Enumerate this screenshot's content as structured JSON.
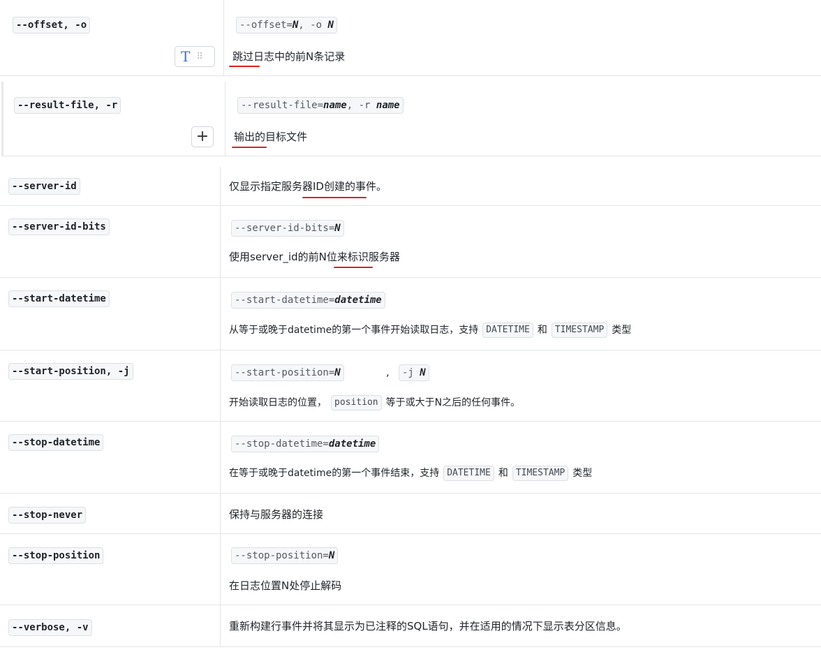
{
  "rows": [
    {
      "option": "--offset, -o",
      "format_pre": "--offset=",
      "format_b1": "N",
      "format_mid": ", -o ",
      "format_b2": "N",
      "description": "跳过日志中的前N条记录"
    },
    {
      "option": "--result-file, -r",
      "format_pre": "--result-file=",
      "format_b1": "name",
      "format_mid": ", -r ",
      "format_b2": "name",
      "description": "输出的目标文件"
    },
    {
      "option": "--server-id",
      "description": "仅显示指定服务器ID创建的事件。"
    },
    {
      "option": "--server-id-bits",
      "format_pre": "--server-id-bits=",
      "format_b1": "N",
      "description": "使用server_id的前N位来标识服务器"
    },
    {
      "option": "--start-datetime",
      "format_pre": "--start-datetime=",
      "format_b1": "datetime",
      "desc_a": "从等于或晚于datetime的第一个事件开始读取日志，支持",
      "code_a": "DATETIME",
      "desc_b": "和",
      "code_b": "TIMESTAMP",
      "desc_c": "类型"
    },
    {
      "option": "--start-position, -j",
      "format_pre": "--start-position=",
      "format_b1": "N",
      "format_sep": ",",
      "format2_pre": "-j ",
      "format2_b": "N",
      "desc_a": "开始读取日志的位置，",
      "code_a": "position",
      "desc_b": "等于或大于N之后的任何事件。"
    },
    {
      "option": "--stop-datetime",
      "format_pre": "--stop-datetime=",
      "format_b1": "datetime",
      "desc_a": "在等于或晚于datetime的第一个事件结束，支持",
      "code_a": "DATETIME",
      "desc_b": "和",
      "code_b": "TIMESTAMP",
      "desc_c": "类型"
    },
    {
      "option": "--stop-never",
      "description": "保持与服务器的连接"
    },
    {
      "option": "--stop-position",
      "format_pre": "--stop-position=",
      "format_b1": "N",
      "description": "在日志位置N处停止解码"
    },
    {
      "option": "--verbose, -v",
      "description": "重新构建行事件并将其显示为已注释的SQL语句，并在适用的情况下显示表分区信息。"
    }
  ],
  "toolbar": {
    "text_button": "T",
    "drag_handle": "⠿",
    "add_button": "+"
  },
  "icons": {
    "text_button": "text-format-icon",
    "drag_handle": "drag-handle-icon",
    "add_button": "plus-icon"
  },
  "colors": {
    "annotation_underline": "#e02020",
    "text_button": "#3b6fe0",
    "border": "#e3e5e8"
  }
}
